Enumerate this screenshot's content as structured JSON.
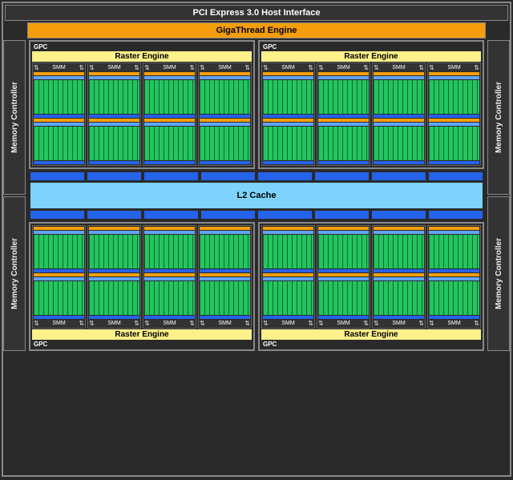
{
  "pci": "PCI Express 3.0 Host Interface",
  "giga": "GigaThread Engine",
  "mem": "Memory Controller",
  "gpc": "GPC",
  "raster": "Raster Engine",
  "smm": "SMM",
  "l2": "L2 Cache",
  "counts": {
    "gpc": 4,
    "smm_per_gpc": 4,
    "blocks_per_smm": 2,
    "mem_controllers": 4
  }
}
